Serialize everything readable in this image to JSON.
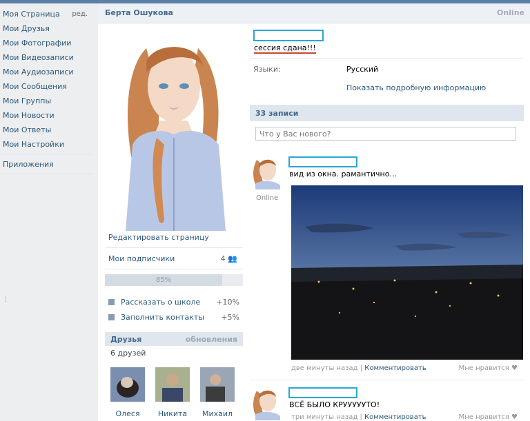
{
  "nav": {
    "edit_label": "ред.",
    "items": [
      {
        "label": "Моя Страница"
      },
      {
        "label": "Мои Друзья"
      },
      {
        "label": "Мои Фотографии"
      },
      {
        "label": "Мои Видеозаписи"
      },
      {
        "label": "Мои Аудиозаписи"
      },
      {
        "label": "Мои Сообщения"
      },
      {
        "label": "Мои Группы"
      },
      {
        "label": "Мои Новости"
      },
      {
        "label": "Мои Ответы"
      },
      {
        "label": "Мои Настройки"
      }
    ],
    "apps_label": "Приложения"
  },
  "profile": {
    "name": "Берта Ошукова",
    "online": "Online",
    "edit_page": "Редактировать страницу",
    "subscribers_label": "Мои подписчики",
    "subscribers_count": "4",
    "completeness": "85%",
    "completeness_value": 0.85,
    "tips": [
      {
        "label": "Рассказать о школе",
        "pct": "+10%"
      },
      {
        "label": "Заполнить контакты",
        "pct": "+5%"
      }
    ]
  },
  "friends": {
    "title": "Друзья",
    "updates": "обновления",
    "count": "6 друзей",
    "list": [
      {
        "name": "Олеся"
      },
      {
        "name": "Никита"
      },
      {
        "name": "Михаил"
      }
    ]
  },
  "info": {
    "status": "сессия сдана!!!",
    "languages_label": "Языки:",
    "languages_value": "Русский",
    "more_info": "Показать подробную информацию"
  },
  "wall": {
    "count": "33 записи",
    "input_placeholder": "Что у Вас нового?",
    "posts": [
      {
        "online": "Online",
        "text": "вид из окна. рамантично...",
        "time": "две минуты назад",
        "comment": "Комментировать",
        "like": "Мне нравится"
      },
      {
        "text": "ВСЁ БЫЛО КРУУУУУТО!",
        "time": "три минуты назад",
        "comment": "Комментировать",
        "like": "Мне нравится"
      }
    ]
  },
  "colors": {
    "accent": "#45688e",
    "link": "#2b587a",
    "highlight": "#2aa7d2"
  }
}
